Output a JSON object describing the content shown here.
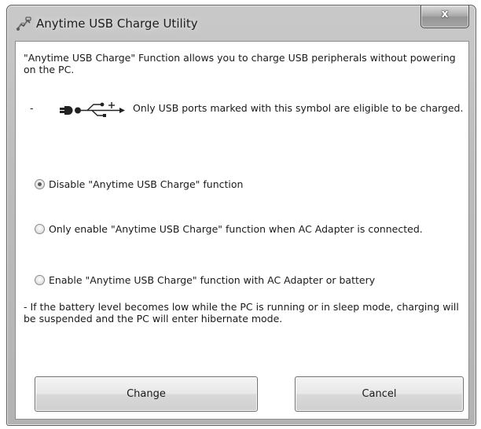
{
  "window": {
    "title": "Anytime USB Charge Utility",
    "close_label": "x"
  },
  "content": {
    "intro": "\"Anytime USB Charge\" Function allows you to charge USB peripherals without powering on the PC.",
    "dash": "-",
    "usb_note": "Only USB ports marked with this symbol are eligible to be charged.",
    "options": [
      {
        "label": "Disable \"Anytime USB Charge\" function",
        "selected": true
      },
      {
        "label": "Only enable \"Anytime USB Charge\" function when AC Adapter is connected.",
        "selected": false
      },
      {
        "label": "Enable \"Anytime USB Charge\" function with AC Adapter or battery",
        "selected": false
      }
    ],
    "footnote": "- If the battery level becomes low while the PC is running or in sleep mode, charging will be suspended and the PC will enter hibernate mode."
  },
  "buttons": {
    "change": "Change",
    "cancel": "Cancel"
  },
  "icons": {
    "app": "app-icon",
    "usb": "usb-charge-icon"
  }
}
